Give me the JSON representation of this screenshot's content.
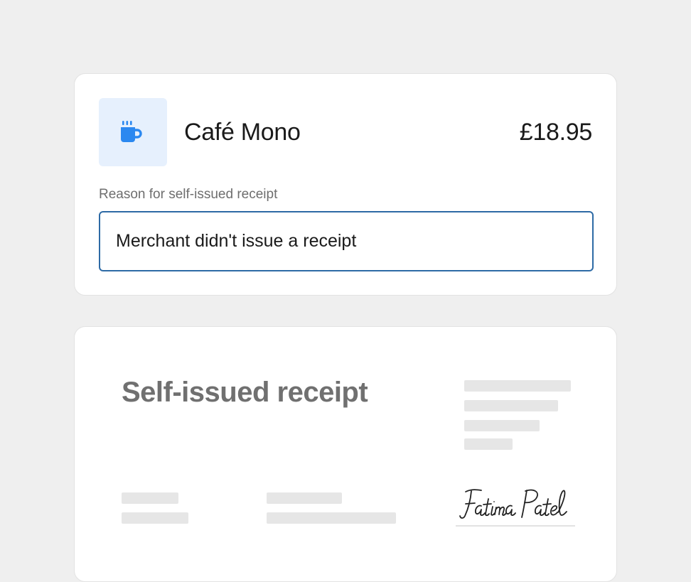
{
  "merchant": {
    "name": "Café Mono",
    "amount": "£18.95",
    "icon": "coffee-cup-icon",
    "icon_color": "#2b88f0",
    "icon_bg": "#e6f0fd"
  },
  "reason": {
    "label": "Reason for self-issued receipt",
    "value": "Merchant didn't issue a receipt",
    "border_color": "#2d6aa5"
  },
  "receipt": {
    "title": "Self-issued receipt",
    "signature": "Fatima Patel"
  }
}
